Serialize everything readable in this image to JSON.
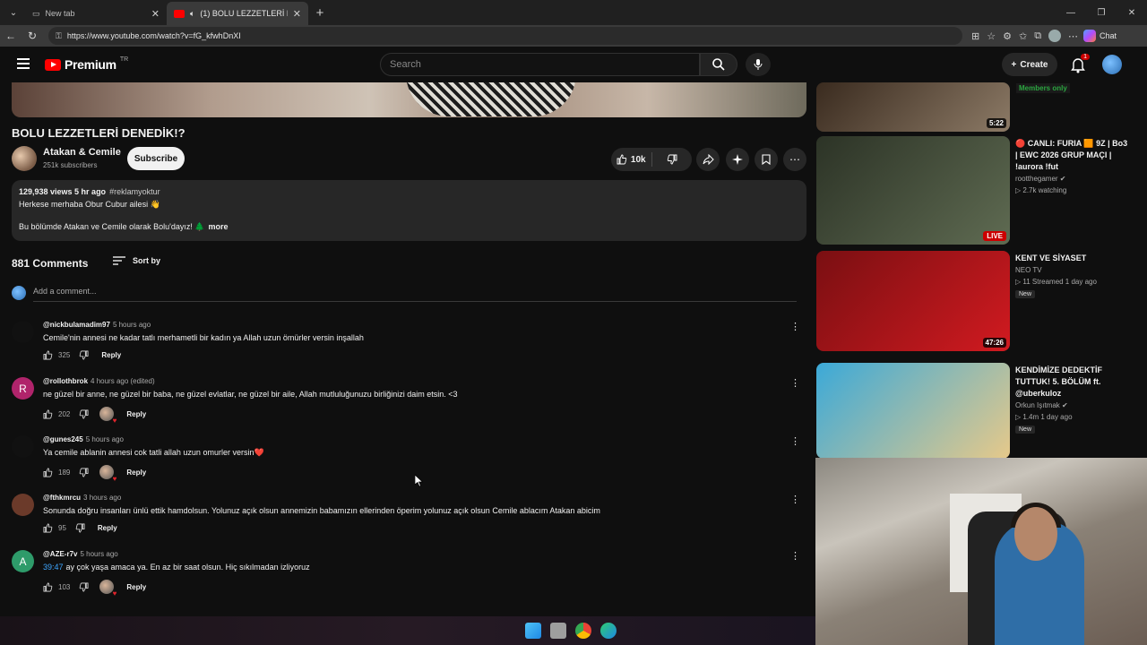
{
  "browser": {
    "tabs": [
      {
        "label": "New tab"
      },
      {
        "label": "(1) BOLU LEZZETLERİ DENEDİK!?"
      }
    ],
    "url": "https://www.youtube.com/watch?v=fG_kfwhDnXI",
    "chat_label": "Chat"
  },
  "header": {
    "logo_text": "Premium",
    "country": "TR",
    "search_placeholder": "Search",
    "create_label": "Create",
    "notification_count": "1"
  },
  "video": {
    "title": "BOLU LEZZETLERİ DENEDİK!?",
    "channel": "Atakan & Cemile",
    "subscribers": "251k subscribers",
    "subscribe_label": "Subscribe",
    "likes": "10k",
    "views_time": "129,938 views  5 hr ago",
    "hashtag": "#reklamyoktur",
    "desc_line1": "Herkese merhaba Obur Cubur ailesi 👋",
    "desc_line2": "Bu bölümde Atakan ve Cemile olarak Bolu'dayız! 🌲",
    "more_label": "more"
  },
  "comments_section": {
    "count": "881 Comments",
    "sort_label": "Sort by",
    "add_placeholder": "Add a comment..."
  },
  "comments": [
    {
      "user": "@nickbulamadim97",
      "time": "5 hours ago",
      "text": "Cemile'nin annesi ne kadar tatlı merhametli bir kadın ya Allah uzun ömürler versin inşallah",
      "likes": "325",
      "avatar_letter": "",
      "avatar_color": "#111111",
      "creator_heart": false
    },
    {
      "user": "@rollothbrok",
      "time": "4 hours ago (edited)",
      "text": "ne güzel bir anne, ne güzel bir baba, ne güzel evlatlar, ne güzel bir aile, Allah mutluluğunuzu birliğinizi daim etsin. <3",
      "likes": "202",
      "avatar_letter": "R",
      "avatar_color": "#b0246b",
      "creator_heart": true
    },
    {
      "user": "@gunes245",
      "time": "5 hours ago",
      "text": "Ya cemile ablanin annesi cok tatli allah uzun omurler versin❤️",
      "likes": "189",
      "avatar_letter": "",
      "avatar_color": "#111111",
      "creator_heart": true
    },
    {
      "user": "@fthkmrcu",
      "time": "3 hours ago",
      "text": "Sonunda doğru insanları ünlü ettik hamdolsun. Yolunuz açık olsun annemizin babamızın ellerinden öperim yolunuz açık olsun Cemile ablacım Atakan abicim",
      "likes": "95",
      "avatar_letter": "",
      "avatar_color": "#6b3a2a",
      "creator_heart": false
    },
    {
      "user": "@AZE-r7v",
      "time": "5 hours ago",
      "timestamp_link": "39:47",
      "text": "ay çok yaşa amaca ya. En az bir saat olsun. Hiç sıkılmadan izliyoruz",
      "likes": "103",
      "avatar_letter": "A",
      "avatar_color": "#2e9b6a",
      "creator_heart": true
    }
  ],
  "reply_label": "Reply",
  "sidebar": [
    {
      "duration": "5:22",
      "badge": "Members only",
      "thumb_colors": [
        "#3a2b1f",
        "#8c7a66"
      ]
    },
    {
      "title": "🔴 CANLI: FURIA 🟧 9Z | Bo3 | EWC 2026 GRUP MAÇI | !aurora !fut",
      "channel": "rootthegamer ✔",
      "meta": "▷ 2.7k watching",
      "live": "LIVE",
      "thumb_colors": [
        "#2c3326",
        "#5f6b52"
      ]
    },
    {
      "title": "KENT VE SİYASET",
      "channel": "NEO TV",
      "meta": "▷ 11  Streamed 1 day ago",
      "new": "New",
      "duration": "47:26",
      "thumb_colors": [
        "#7a0f12",
        "#d11a20"
      ]
    },
    {
      "title": "KENDİMİZE DEDEKTİF TUTTUK! 5. BÖLÜM ft. @uberkuloz",
      "channel": "Orkun Işıtmak ✔",
      "meta": "▷ 1.4m  1 day ago",
      "new": "New",
      "thumb_colors": [
        "#3ba9d8",
        "#e6c98a"
      ]
    }
  ]
}
